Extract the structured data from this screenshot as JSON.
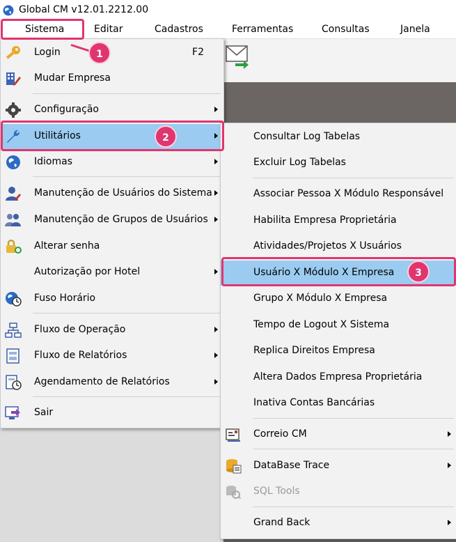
{
  "window": {
    "title": "Global CM v12.01.2212.00"
  },
  "menubar": {
    "items": [
      {
        "label": "Sistema"
      },
      {
        "label": "Editar"
      },
      {
        "label": "Cadastros"
      },
      {
        "label": "Ferramentas"
      },
      {
        "label": "Consultas"
      },
      {
        "label": "Janela"
      }
    ]
  },
  "sistema_menu": {
    "items": [
      {
        "label": "Login",
        "shortcut": "F2",
        "icon": "key-icon"
      },
      {
        "label": "Mudar Empresa",
        "icon": "building-edit-icon"
      },
      {
        "label": "Configuração",
        "icon": "gear-icon",
        "submenu": true
      },
      {
        "label": "Utilitários",
        "icon": "wrench-icon",
        "submenu": true,
        "highlighted": true
      },
      {
        "label": "Idiomas",
        "icon": "globe-icon",
        "submenu": true
      },
      {
        "label": "Manutenção de Usuários do Sistema",
        "icon": "user-edit-icon",
        "submenu": true
      },
      {
        "label": "Manutenção de Grupos de Usuários",
        "icon": "users-group-icon",
        "submenu": true
      },
      {
        "label": "Alterar senha",
        "icon": "lock-icon"
      },
      {
        "label": "Autorização por Hotel",
        "submenu": true
      },
      {
        "label": "Fuso Horário",
        "icon": "globe-clock-icon"
      },
      {
        "label": "Fluxo de Operação",
        "icon": "flow-icon",
        "submenu": true
      },
      {
        "label": "Fluxo de Relatórios",
        "icon": "report-flow-icon",
        "submenu": true
      },
      {
        "label": "Agendamento de Relatórios",
        "icon": "report-schedule-icon",
        "submenu": true
      },
      {
        "label": "Sair",
        "icon": "exit-icon"
      }
    ]
  },
  "utilitarios_submenu": {
    "items": [
      {
        "label": "Consultar Log Tabelas"
      },
      {
        "label": "Excluir Log Tabelas"
      },
      {
        "label": "Associar Pessoa X Módulo Responsável"
      },
      {
        "label": "Habilita Empresa Proprietária"
      },
      {
        "label": "Atividades/Projetos X Usuários"
      },
      {
        "label": "Usuário X Módulo X Empresa",
        "highlighted": true
      },
      {
        "label": "Grupo X Módulo X Empresa"
      },
      {
        "label": "Tempo de Logout X Sistema"
      },
      {
        "label": "Replica Direitos Empresa"
      },
      {
        "label": "Altera Dados Empresa Proprietária"
      },
      {
        "label": "Inativa Contas Bancárias"
      },
      {
        "label": "Correio CM",
        "icon": "mail-icon",
        "submenu": true
      },
      {
        "label": "DataBase Trace",
        "icon": "database-trace-icon",
        "submenu": true
      },
      {
        "label": "SQL Tools",
        "icon": "sql-tools-icon",
        "disabled": true
      },
      {
        "label": "Grand Back",
        "submenu": true
      }
    ]
  },
  "callouts": [
    {
      "number": "1"
    },
    {
      "number": "2"
    },
    {
      "number": "3"
    }
  ],
  "colors": {
    "highlight_blue": "#9bcbf0",
    "callout_pink": "#e0356f",
    "menu_bg": "#f2f2f2",
    "background_gray": "#6b6663"
  }
}
